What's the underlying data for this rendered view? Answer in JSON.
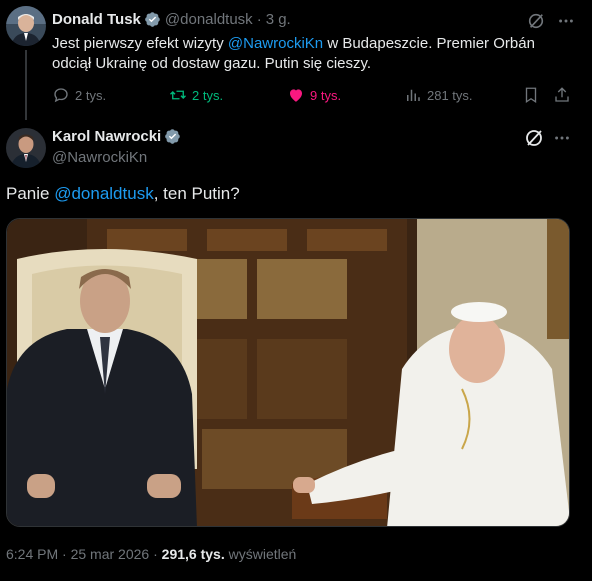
{
  "tweet1": {
    "name": "Donald Tusk",
    "handle": "@donaldtusk",
    "separator": "·",
    "time": "3 g.",
    "text_before": "Jest pierwszy efekt wizyty ",
    "mention": "@NawrockiKn",
    "text_after": " w Budapeszcie. Premier Orbán odciął Ukrainę od dostaw gazu. Putin się cieszy.",
    "replies": "2 tys.",
    "retweets": "2 tys.",
    "likes": "9 tys.",
    "views": "281 tys.",
    "icons": [
      "verified-badge-icon",
      "grok-icon",
      "more-icon",
      "reply-icon",
      "retweet-icon",
      "heart-icon",
      "views-icon",
      "bookmark-icon",
      "share-icon"
    ],
    "colors": {
      "retweet": "#00ba7c",
      "like": "#f91880",
      "mention": "#1d9bf0"
    }
  },
  "tweet2": {
    "name": "Karol Nawrocki",
    "handle": "@NawrockiKn",
    "text_prefix": "Panie ",
    "mention": "@donaldtusk",
    "text_suffix": ", ten Putin?",
    "time": "6:24 PM",
    "separator": "·",
    "date": "25 mar 2026",
    "dot2": "·",
    "views_count": "291,6 tys.",
    "views_label": "wyświetleń"
  }
}
